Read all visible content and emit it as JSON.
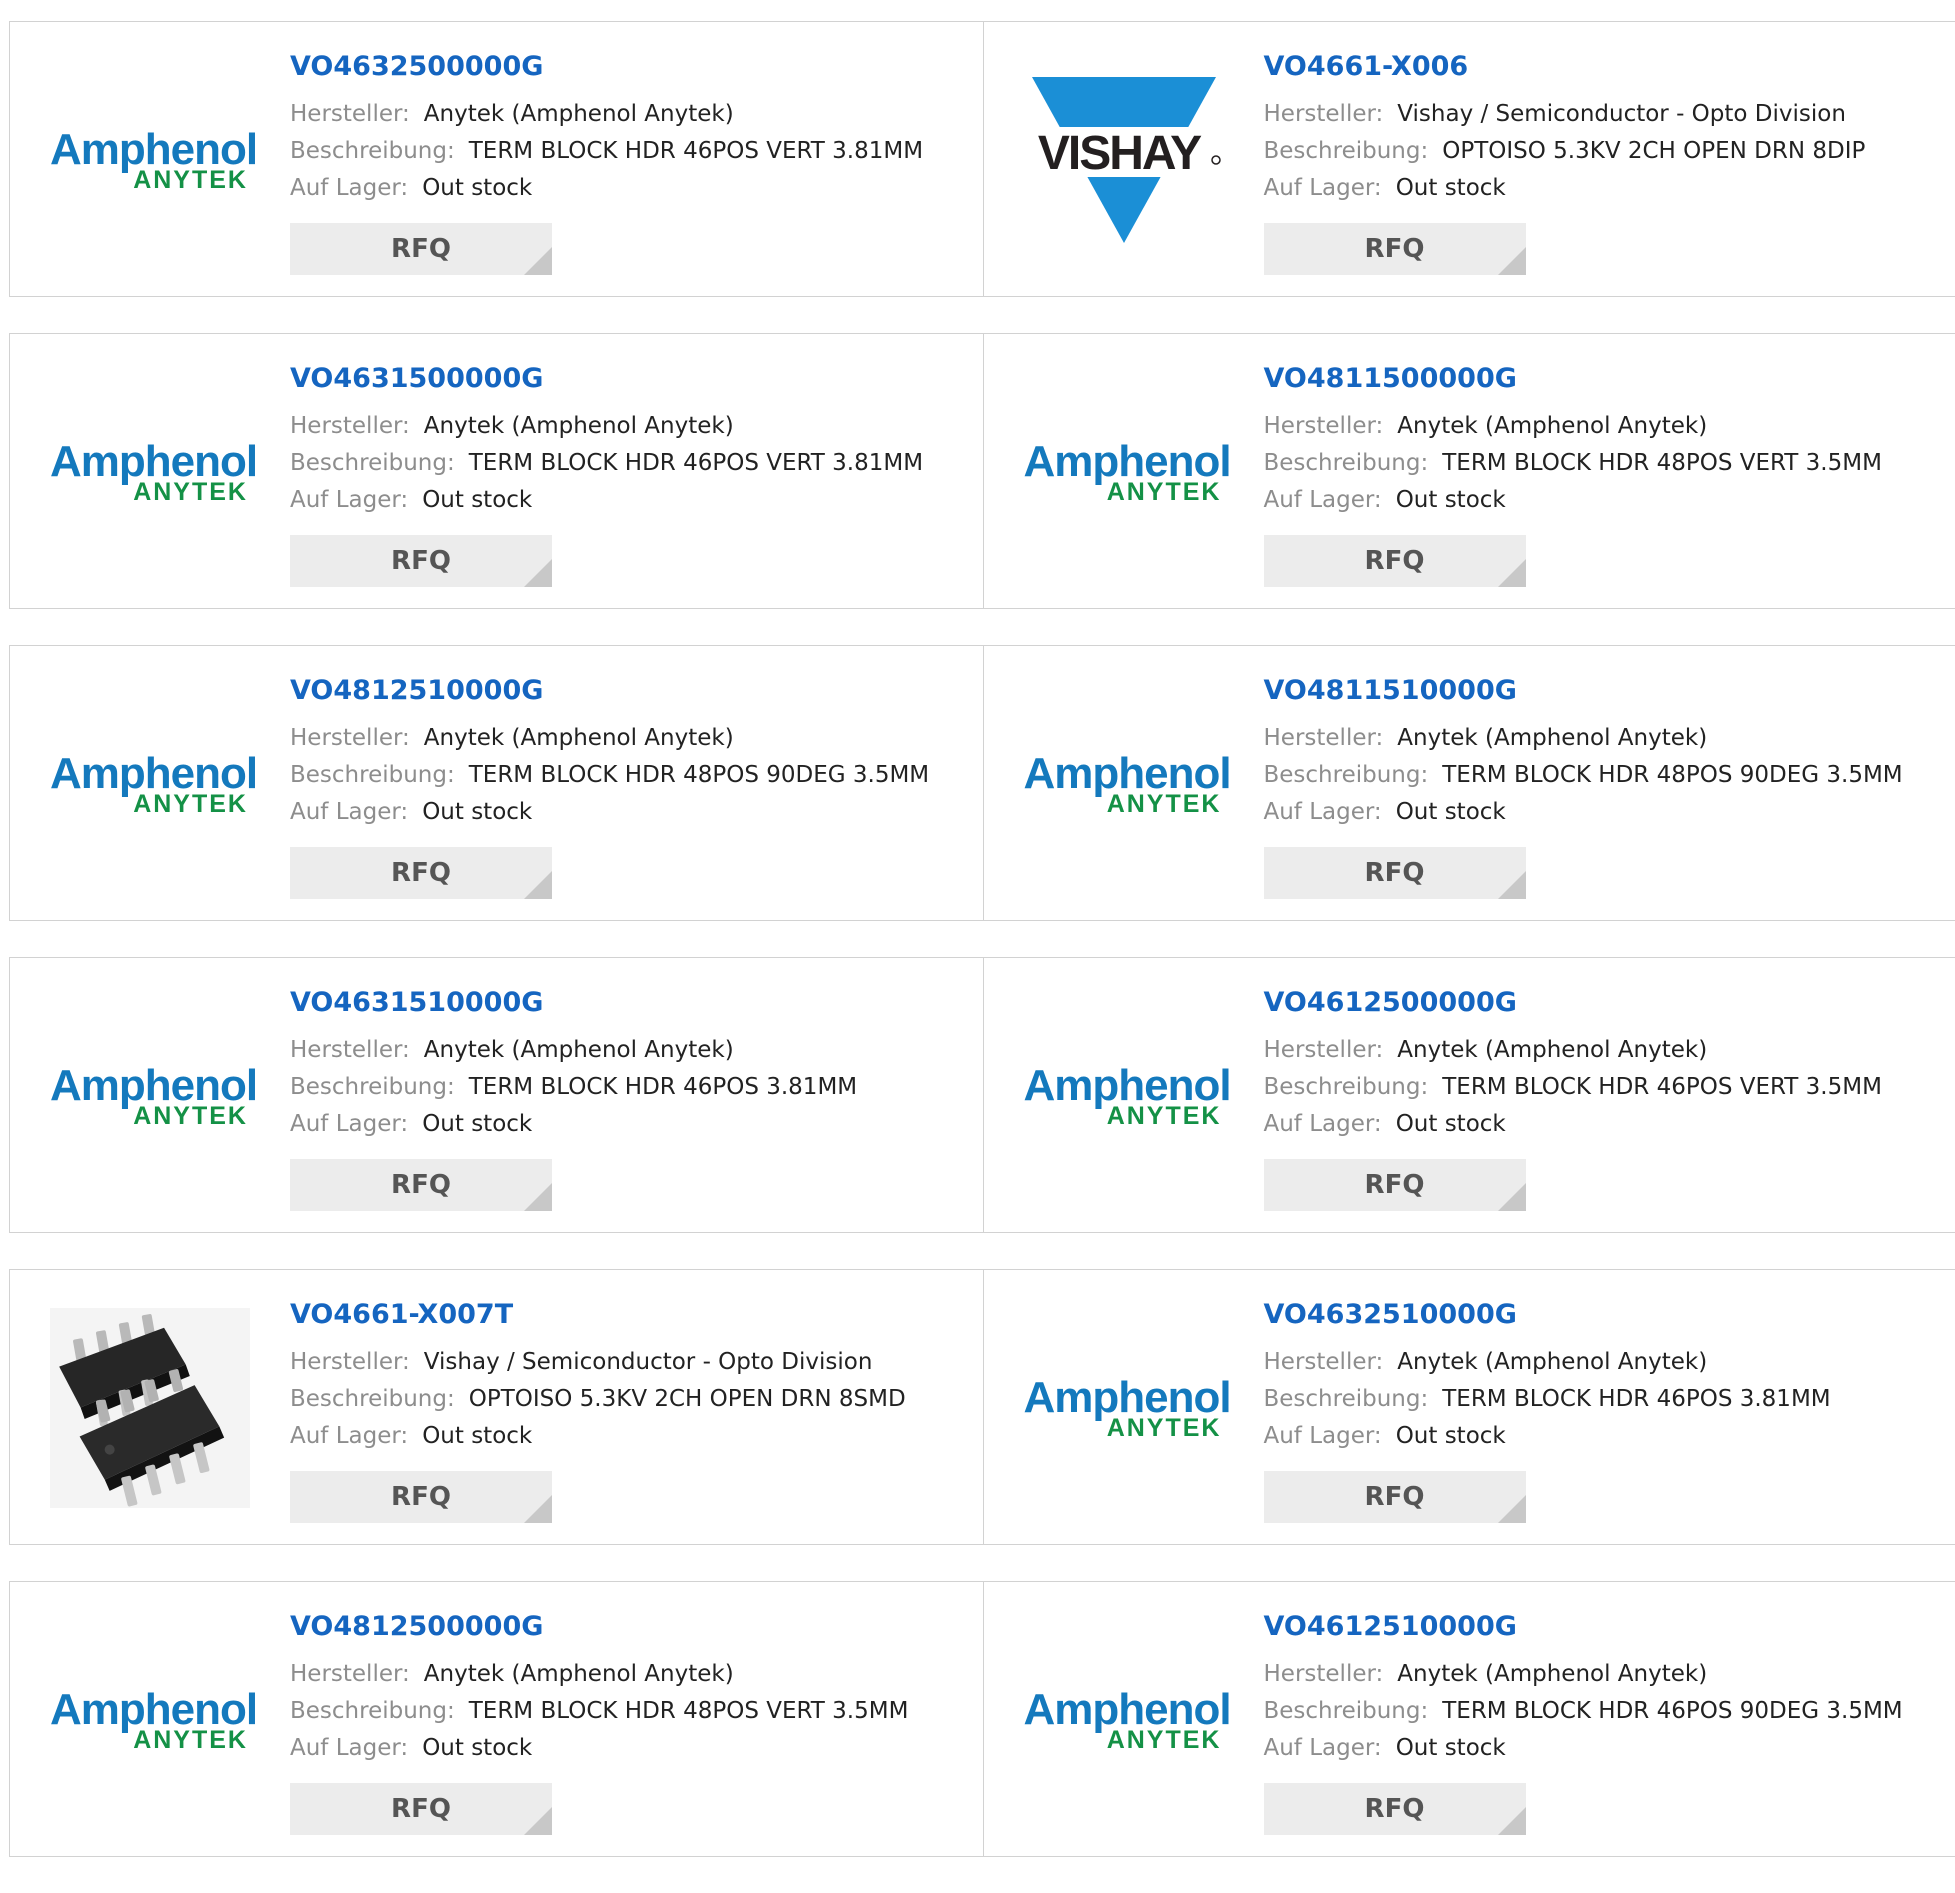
{
  "labels": {
    "manufacturer": "Hersteller:",
    "description": "Beschreibung:",
    "stock": "Auf Lager:",
    "rfq": "RFQ"
  },
  "logos": {
    "amphenol": {
      "line1": "Amphenol",
      "line2": "ANYTEK"
    },
    "vishay": {
      "text": "VISHAY"
    }
  },
  "colors": {
    "link": "#1565c0",
    "label": "#8d8d8d",
    "button_bg": "#ececec",
    "amphenol_blue": "#1479bd",
    "anytek_green": "#149146",
    "vishay_blue": "#1b8fd6"
  },
  "products": [
    {
      "part": "VO4632500000G",
      "logo": "amphenol-logo",
      "manufacturer": "Anytek (Amphenol Anytek)",
      "description": "TERM BLOCK HDR 46POS VERT 3.81MM",
      "stock": "Out stock"
    },
    {
      "part": "VO4661-X006",
      "logo": "vishay-logo",
      "manufacturer": "Vishay / Semiconductor - Opto Division",
      "description": "OPTOISO 5.3KV 2CH OPEN DRN 8DIP",
      "stock": "Out stock"
    },
    {
      "part": "VO4631500000G",
      "logo": "amphenol-logo",
      "manufacturer": "Anytek (Amphenol Anytek)",
      "description": "TERM BLOCK HDR 46POS VERT 3.81MM",
      "stock": "Out stock"
    },
    {
      "part": "VO4811500000G",
      "logo": "amphenol-logo",
      "manufacturer": "Anytek (Amphenol Anytek)",
      "description": "TERM BLOCK HDR 48POS VERT 3.5MM",
      "stock": "Out stock"
    },
    {
      "part": "VO4812510000G",
      "logo": "amphenol-logo",
      "manufacturer": "Anytek (Amphenol Anytek)",
      "description": "TERM BLOCK HDR 48POS 90DEG 3.5MM",
      "stock": "Out stock"
    },
    {
      "part": "VO4811510000G",
      "logo": "amphenol-logo",
      "manufacturer": "Anytek (Amphenol Anytek)",
      "description": "TERM BLOCK HDR 48POS 90DEG 3.5MM",
      "stock": "Out stock"
    },
    {
      "part": "VO4631510000G",
      "logo": "amphenol-logo",
      "manufacturer": "Anytek (Amphenol Anytek)",
      "description": "TERM BLOCK HDR 46POS 3.81MM",
      "stock": "Out stock"
    },
    {
      "part": "VO4612500000G",
      "logo": "amphenol-logo",
      "manufacturer": "Anytek (Amphenol Anytek)",
      "description": "TERM BLOCK HDR 46POS VERT 3.5MM",
      "stock": "Out stock"
    },
    {
      "part": "VO4661-X007T",
      "logo": "chip-photo",
      "manufacturer": "Vishay / Semiconductor - Opto Division",
      "description": "OPTOISO 5.3KV 2CH OPEN DRN 8SMD",
      "stock": "Out stock"
    },
    {
      "part": "VO4632510000G",
      "logo": "amphenol-logo",
      "manufacturer": "Anytek (Amphenol Anytek)",
      "description": "TERM BLOCK HDR 46POS 3.81MM",
      "stock": "Out stock"
    },
    {
      "part": "VO4812500000G",
      "logo": "amphenol-logo",
      "manufacturer": "Anytek (Amphenol Anytek)",
      "description": "TERM BLOCK HDR 48POS VERT 3.5MM",
      "stock": "Out stock"
    },
    {
      "part": "VO4612510000G",
      "logo": "amphenol-logo",
      "manufacturer": "Anytek (Amphenol Anytek)",
      "description": "TERM BLOCK HDR 46POS 90DEG 3.5MM",
      "stock": "Out stock"
    }
  ]
}
